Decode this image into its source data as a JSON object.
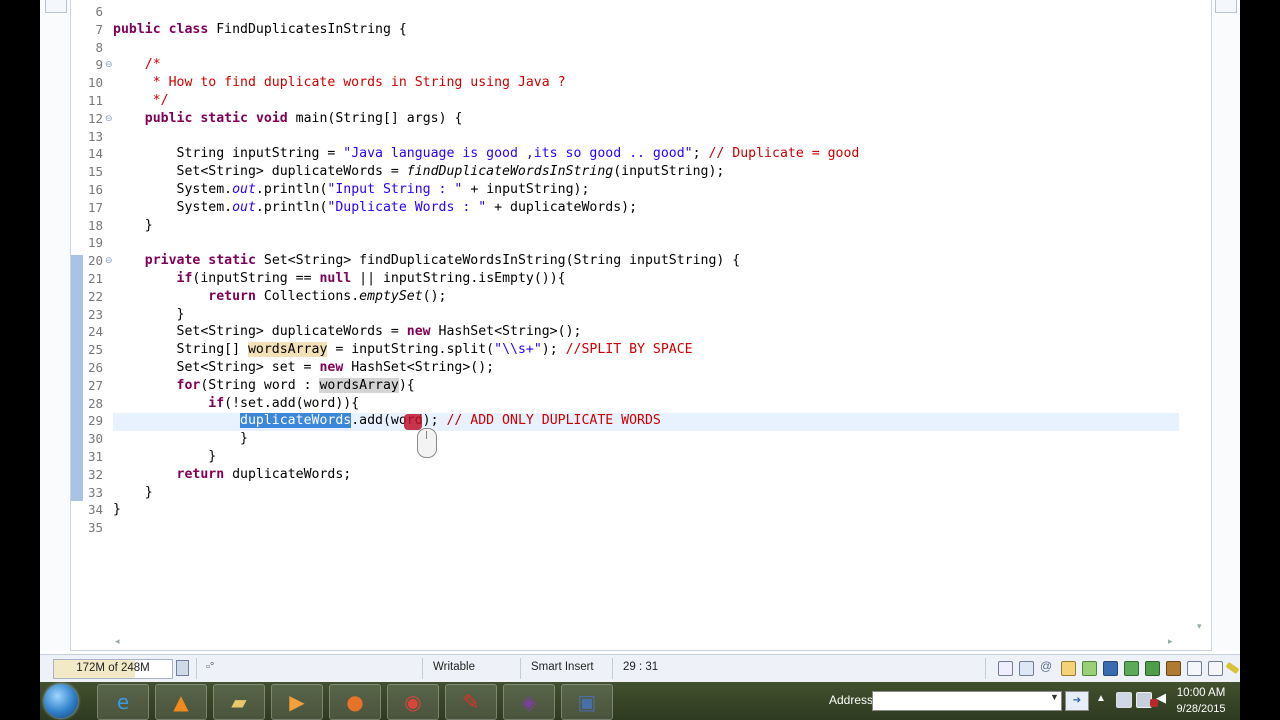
{
  "editor": {
    "lines": [
      {
        "n": "6",
        "html": ""
      },
      {
        "n": "7",
        "html": "<span class=\"kw\">public</span> <span class=\"kw\">class</span> FindDuplicatesInString {"
      },
      {
        "n": "8",
        "html": ""
      },
      {
        "n": "9",
        "fold": true,
        "html": "    <span class=\"cm\">/*</span>"
      },
      {
        "n": "10",
        "html": "<span class=\"cm\">     * How to find duplicate words in String using Java ?</span>"
      },
      {
        "n": "11",
        "html": "<span class=\"cm\">     */</span>"
      },
      {
        "n": "12",
        "fold": true,
        "html": "    <span class=\"kw\">public</span> <span class=\"kw\">static</span> <span class=\"kw\">void</span> main(String[] args) {"
      },
      {
        "n": "13",
        "html": ""
      },
      {
        "n": "14",
        "html": "        String inputString = <span class=\"str\">\"Java language is good ,its so good .. good\"</span>; <span class=\"cm\">// Duplicate = good</span>"
      },
      {
        "n": "15",
        "html": "        Set&lt;String&gt; duplicateWords = <span class=\"it\">findDuplicateWordsInString</span>(inputString);"
      },
      {
        "n": "16",
        "html": "        System.<span class=\"it str\">out</span>.println(<span class=\"str\">\"Input String : \"</span> + inputString);"
      },
      {
        "n": "17",
        "html": "        System.<span class=\"it str\">out</span>.println(<span class=\"str\">\"Duplicate Words : \"</span> + duplicateWords);"
      },
      {
        "n": "18",
        "html": "    }"
      },
      {
        "n": "19",
        "html": ""
      },
      {
        "n": "20",
        "fold": true,
        "html": "    <span class=\"kw\">private</span> <span class=\"kw\">static</span> Set&lt;String&gt; findDuplicateWordsInString(String inputString) {"
      },
      {
        "n": "21",
        "html": "        <span class=\"kw\">if</span>(inputString == <span class=\"kw\">null</span> || inputString.isEmpty()){"
      },
      {
        "n": "22",
        "html": "            <span class=\"kw\">return</span> Collections.<span class=\"it\">emptySet</span>();"
      },
      {
        "n": "23",
        "html": "        }"
      },
      {
        "n": "24",
        "html": "        Set&lt;String&gt; duplicateWords = <span class=\"kw\">new</span> HashSet&lt;String&gt;();"
      },
      {
        "n": "25",
        "html": "        String[] <span class=\"mark\">wordsArray</span> = inputString.split(<span class=\"str\">\"\\\\s+\"</span>); <span class=\"cm\">//SPLIT BY SPACE</span>"
      },
      {
        "n": "26",
        "html": "        Set&lt;String&gt; set = <span class=\"kw\">new</span> HashSet&lt;String&gt;();"
      },
      {
        "n": "27",
        "html": "        <span class=\"kw\">for</span>(String word : <span class=\"mark2\">wordsArray</span>){"
      },
      {
        "n": "28",
        "html": "            <span class=\"kw\">if</span>(!set.add(word)){"
      },
      {
        "n": "29",
        "html": "                <span class=\"sel\">duplicateWords</span>.add(word); <span class=\"cm\">// ADD ONLY DUPLICATE WORDS</span>"
      },
      {
        "n": "30",
        "html": "                }"
      },
      {
        "n": "31",
        "html": "            }"
      },
      {
        "n": "32",
        "html": "        <span class=\"kw\">return</span> duplicateWords;"
      },
      {
        "n": "33",
        "html": "    }"
      },
      {
        "n": "34",
        "html": "}"
      },
      {
        "n": "35",
        "html": ""
      }
    ]
  },
  "status": {
    "heap": "172M of 248M",
    "heap_used_fraction": 0.69,
    "mode": "Writable",
    "insert_mode": "Smart Insert",
    "position": "29 : 31"
  },
  "taskbar": {
    "address_label": "Address",
    "address_value": "",
    "time": "10:00 AM",
    "date": "9/28/2015",
    "apps": [
      {
        "name": "ie-icon",
        "glyph": "e",
        "color": "#3a9ae0"
      },
      {
        "name": "vlc-icon",
        "glyph": "▲",
        "color": "#f08a1c"
      },
      {
        "name": "explorer-folder-icon",
        "glyph": "▰",
        "color": "#e7c86a"
      },
      {
        "name": "media-player-icon",
        "glyph": "▶",
        "color": "#f2a03a"
      },
      {
        "name": "firefox-icon",
        "glyph": "●",
        "color": "#e8722a"
      },
      {
        "name": "chrome-icon",
        "glyph": "◉",
        "color": "#d8453a"
      },
      {
        "name": "acrobat-icon",
        "glyph": "✎",
        "color": "#e0302a"
      },
      {
        "name": "eclipse-ide-icon",
        "glyph": "◈",
        "color": "#7b3fa0"
      },
      {
        "name": "save-disk-icon",
        "glyph": "▣",
        "color": "#4a6ea8"
      }
    ]
  }
}
